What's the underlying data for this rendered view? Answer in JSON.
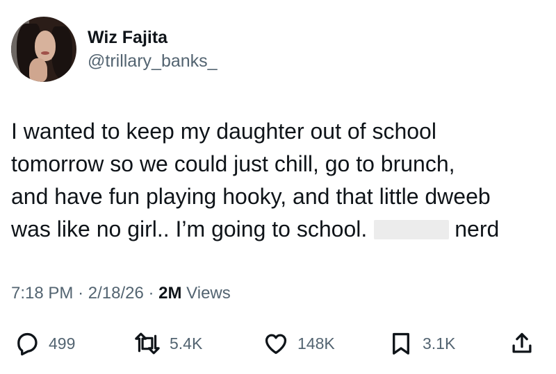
{
  "author": {
    "display_name": "Wiz Fajita",
    "handle": "@trillary_banks_"
  },
  "tweet": {
    "lines": [
      "I wanted to keep my daughter out of school",
      "tomorrow so we could just chill, go to brunch,",
      "and have fun playing hooky, and that little dweeb",
      "was like no girl.. I’m going to school."
    ],
    "last_word": "nerd"
  },
  "meta": {
    "time": "7:18 PM",
    "date": "2/18/26",
    "separator": "·",
    "views_count": "2M",
    "views_label": "Views"
  },
  "actions": {
    "replies": "499",
    "reposts": "5.4K",
    "likes": "148K",
    "bookmarks": "3.1K"
  },
  "colors": {
    "text": "#0f1419",
    "secondary": "#536471",
    "redaction": "#ececec"
  },
  "icons": [
    "reply-icon",
    "repost-icon",
    "like-icon",
    "bookmark-icon",
    "share-icon"
  ]
}
